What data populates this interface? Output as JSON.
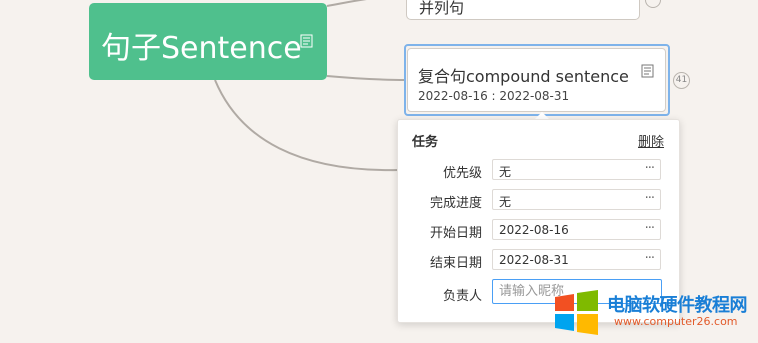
{
  "mindmap": {
    "root": {
      "title": "句子Sentence"
    },
    "top_node": {
      "title": "并列句"
    },
    "compound_node": {
      "title": "复合句compound sentence",
      "date_range": "2022-08-16 : 2022-08-31",
      "badge": "41"
    }
  },
  "task_panel": {
    "title": "任务",
    "delete_label": "删除",
    "fields": {
      "priority": {
        "label": "优先级",
        "value": "无"
      },
      "progress": {
        "label": "完成进度",
        "value": "无"
      },
      "start_date": {
        "label": "开始日期",
        "value": "2022-08-16"
      },
      "end_date": {
        "label": "结束日期",
        "value": "2022-08-31"
      },
      "assignee": {
        "label": "负责人",
        "placeholder": "请输入昵称"
      }
    },
    "more_glyph": "···"
  },
  "watermark": {
    "name": "电脑软硬件教程网",
    "url": "www.computer26.com"
  },
  "colors": {
    "root_node": "#4fc08d",
    "selection": "#7eb3ea",
    "canvas": "#f6f2ee",
    "input_focus": "#4a9ff5"
  }
}
